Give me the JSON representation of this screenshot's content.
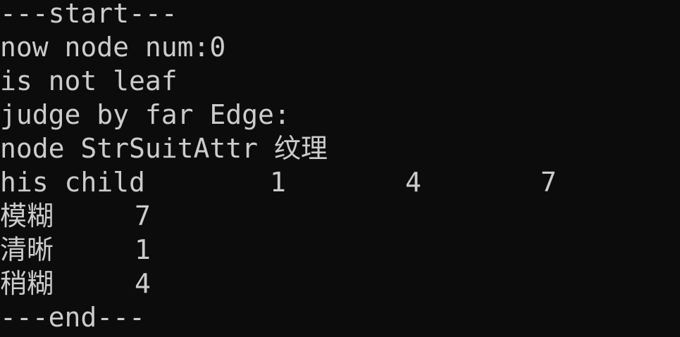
{
  "colors": {
    "background": "#0c0c0c",
    "foreground": "#cccccc"
  },
  "console": {
    "line1": "---start---",
    "line2": "now node num:0",
    "line3": "is not leaf",
    "line4": "judge by far Edge:",
    "line5": "node StrSuitAttr 纹理",
    "children_row": {
      "label": "his child",
      "values": [
        "1",
        "4",
        "7"
      ]
    },
    "branches": [
      {
        "name": "模糊",
        "child": "7"
      },
      {
        "name": "清晰",
        "child": "1"
      },
      {
        "name": "稍糊",
        "child": "4"
      }
    ],
    "end_line": "---end---"
  }
}
